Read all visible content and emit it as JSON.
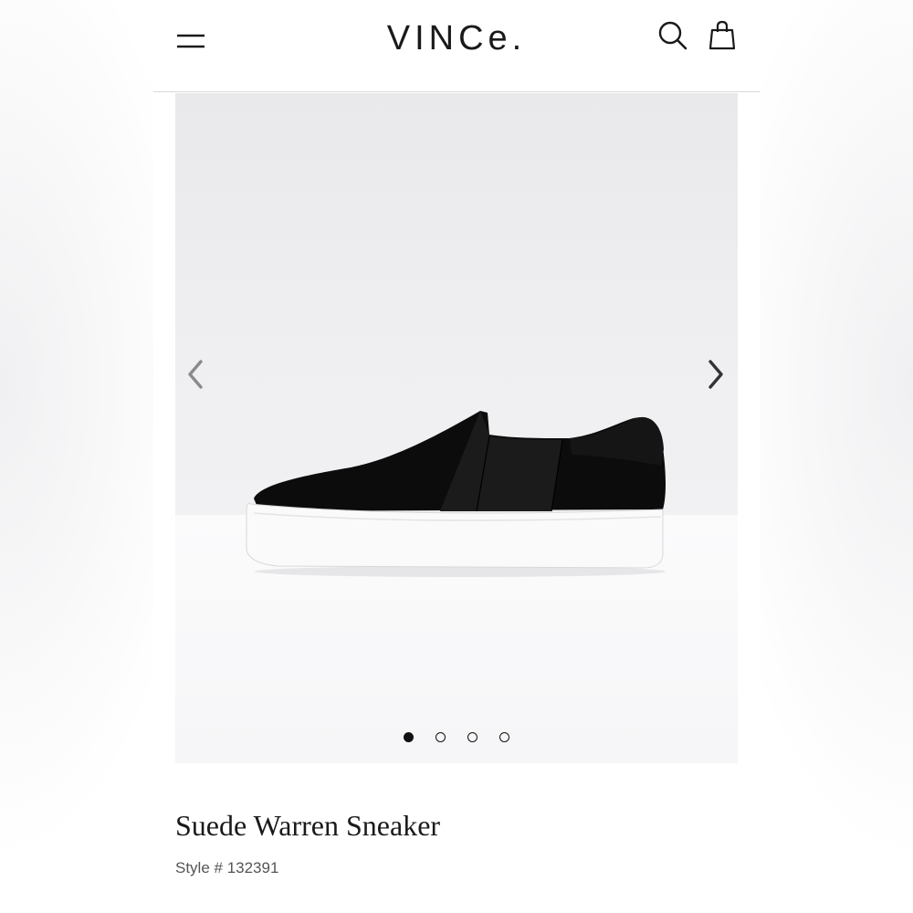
{
  "header": {
    "logo_text": "VINCe.",
    "menu_icon": "hamburger-menu-icon",
    "search_icon": "search-icon",
    "bag_icon": "shopping-bag-icon"
  },
  "gallery": {
    "image_alt": "Suede Warren Sneaker",
    "prev_icon": "chevron-left-icon",
    "next_icon": "chevron-right-icon",
    "slide_count": 4,
    "active_slide": 1,
    "background": "#ececee",
    "floor": "#f8f8fa"
  },
  "product": {
    "title": "Suede Warren Sneaker",
    "style_number": "Style # 132391"
  },
  "colors": {
    "text_primary": "#1a1a1a",
    "text_secondary": "#555555",
    "divider": "#d9d9d9"
  }
}
